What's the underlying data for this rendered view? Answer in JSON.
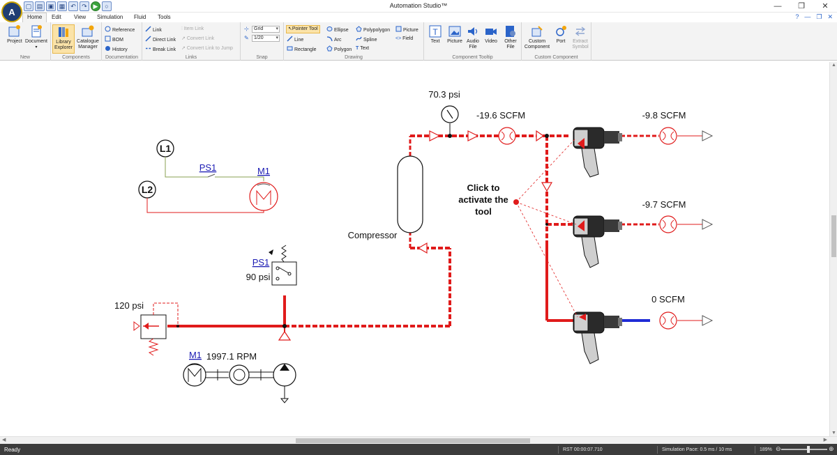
{
  "window": {
    "title": "Automation Studio™"
  },
  "menu": {
    "tabs": [
      "Home",
      "Edit",
      "View",
      "Simulation",
      "Fluid",
      "Tools"
    ]
  },
  "ribbon": {
    "groups": {
      "new": "New",
      "components": "Components",
      "documentation": "Documentation",
      "links": "Links",
      "snap": "Snap",
      "drawing": "Drawing",
      "tooltip": "Component Tooltip",
      "custom": "Custom Component"
    },
    "new": {
      "project": "Project",
      "document": "Document"
    },
    "components": {
      "library_explorer": "Library Explorer",
      "catalogue_manager": "Catalogue Manager"
    },
    "documentation": {
      "reference": "Reference",
      "bom": "BOM",
      "history": "History"
    },
    "links": {
      "link": "Link",
      "direct_link": "Direct Link",
      "break_link": "Break Link",
      "item_link": "Item Link",
      "convert_link": "Convert Link",
      "convert_link_to_jump": "Convert Link to Jump"
    },
    "snap": {
      "grid": "Grid",
      "ratio": "1/20"
    },
    "drawing": {
      "pointer_tool": "Pointer Tool",
      "line": "Line",
      "rectangle": "Rectangle",
      "ellipse": "Ellipse",
      "arc": "Arc",
      "polygon": "Polygon",
      "polypolygon": "Polypolygon",
      "spline": "Spline",
      "text": "Text",
      "picture": "Picture",
      "field": "Field"
    },
    "tooltip": {
      "text": "Text",
      "picture": "Picture",
      "audio_file": "Audio File",
      "video": "Video",
      "other_file": "Other File"
    },
    "custom": {
      "custom_component": "Custom Component",
      "port": "Port",
      "extract_symbol": "Extract Symbol"
    }
  },
  "diagram": {
    "gauge_reading": "70.3 psi",
    "flow_main": "-19.6 SCFM",
    "flow_tool1": "-9.8 SCFM",
    "flow_tool2": "-9.7 SCFM",
    "flow_tool3": "0 SCFM",
    "callout": [
      "Click to",
      "activate the",
      "tool"
    ],
    "compressor": "Compressor",
    "l1": "L1",
    "l2": "L2",
    "ps1_top": "PS1",
    "m1_top": "M1",
    "ps1_switch": "PS1",
    "ps1_setting": "90 psi",
    "relief_setting": "120 psi",
    "m1_bottom": "M1",
    "motor_speed": "1997.1 RPM"
  },
  "status": {
    "ready": "Ready",
    "time": "RST 00:00:07.710",
    "sim_pace": "Simulation Pace: 0.5 ms / 10 ms",
    "zoom": "189%"
  },
  "colors": {
    "pressure": "#e01b1b",
    "tank_line": "#e01b1b",
    "exhaust": "#1f2bd6",
    "signal": "#8aa050",
    "accent": "#2b64c9"
  }
}
